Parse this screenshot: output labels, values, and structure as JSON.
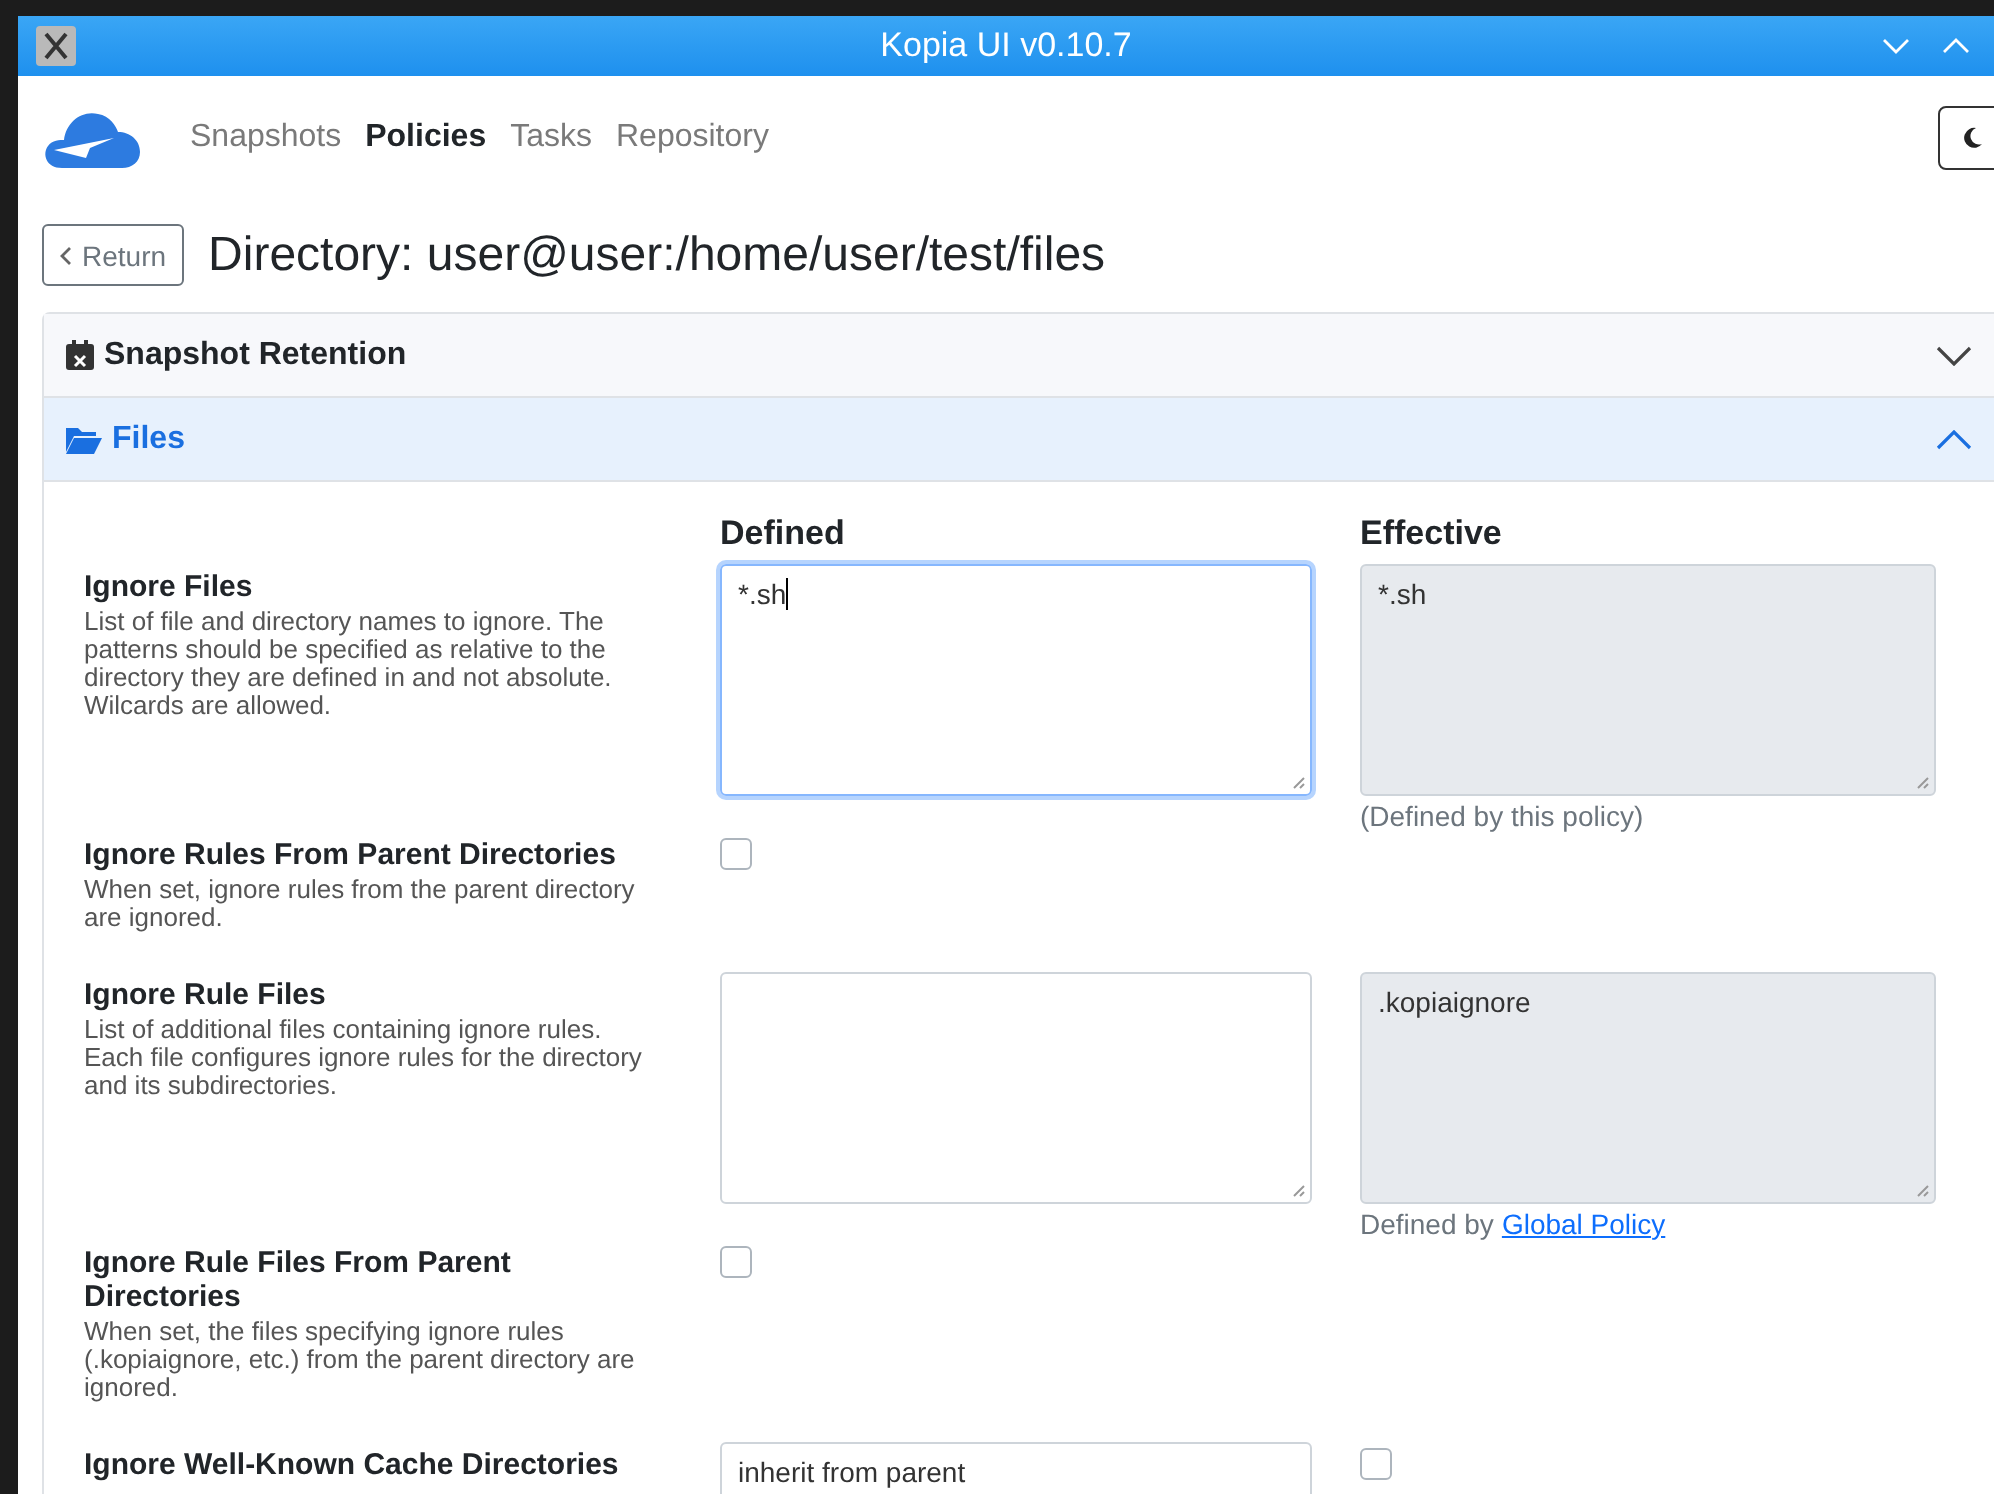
{
  "window": {
    "title": "Kopia UI v0.10.7"
  },
  "nav": {
    "items": [
      {
        "label": "Snapshots",
        "selected": false
      },
      {
        "label": "Policies",
        "selected": true
      },
      {
        "label": "Tasks",
        "selected": false
      },
      {
        "label": "Repository",
        "selected": false
      }
    ]
  },
  "header": {
    "return_button": "Return",
    "title": "Directory: user@user:/home/user/test/files"
  },
  "sections": [
    {
      "title": "Snapshot Retention",
      "kind": "retention",
      "expanded": false
    },
    {
      "title": "Files",
      "kind": "files",
      "expanded": true
    }
  ],
  "columns": {
    "defined": "Defined",
    "effective": "Effective"
  },
  "rows": [
    {
      "label": "Ignore Files",
      "description": "List of file and directory names to ignore. The patterns should be specified as relative to the directory they are defined in and not absolute. Wilcards are allowed.",
      "kind": "textarea",
      "defined": {
        "value": "*.sh",
        "focused": true
      },
      "effective": {
        "kind": "textarea",
        "value": "*.sh",
        "note": {
          "text": "(Defined by this policy)"
        }
      }
    },
    {
      "label": "Ignore Rules From Parent Directories",
      "description": "When set, ignore rules from the parent directory are ignored.",
      "kind": "checkbox",
      "defined": {
        "checked": false
      }
    },
    {
      "label": "Ignore Rule Files",
      "description": "List of additional files containing ignore rules. Each file configures ignore rules for the directory and its subdirectories.",
      "kind": "textarea",
      "defined": {
        "focused": false
      },
      "effective": {
        "kind": "textarea",
        "value": ".kopiaignore",
        "note": {
          "text": "Defined by",
          "link": "Global Policy"
        }
      }
    },
    {
      "label": "Ignore Rule Files From Parent Directories",
      "description": "When set, the files specifying ignore rules (.kopiaignore, etc.) from the parent directory are ignored.",
      "kind": "checkbox",
      "defined": {
        "checked": false
      }
    },
    {
      "label": "Ignore Well-Known Cache Directories",
      "kind": "select",
      "defined": {
        "value": "inherit from parent"
      },
      "effective": {
        "kind": "checkbox",
        "checked": false
      }
    }
  ]
}
